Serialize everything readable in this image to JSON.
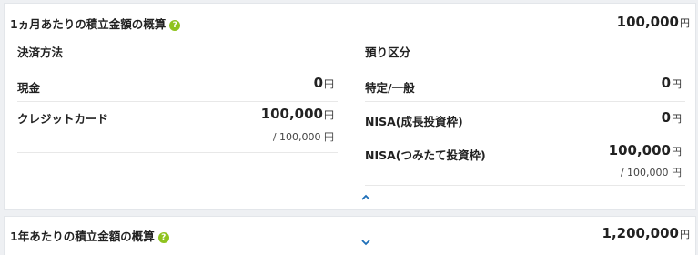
{
  "monthly": {
    "title": "1ヵ月あたりの積立金額の概算",
    "help_icon": "question-mark-icon",
    "total_value": "100,000",
    "unit": "円",
    "payment": {
      "heading": "決済方法",
      "rows": [
        {
          "label": "現金",
          "amount": "0",
          "unit": "円",
          "sub": ""
        },
        {
          "label": "クレジットカード",
          "amount": "100,000",
          "unit": "円",
          "sub": "/ 100,000 円"
        }
      ]
    },
    "deposit": {
      "heading": "預り区分",
      "rows": [
        {
          "label": "特定/一般",
          "amount": "0",
          "unit": "円",
          "sub": ""
        },
        {
          "label": "NISA(成長投資枠)",
          "amount": "0",
          "unit": "円",
          "sub": ""
        },
        {
          "label": "NISA(つみたて投資枠)",
          "amount": "100,000",
          "unit": "円",
          "sub": "/ 100,000 円"
        }
      ]
    },
    "collapse_icon": "chevron-up-icon"
  },
  "yearly": {
    "title": "1年あたりの積立金額の概算",
    "help_icon": "question-mark-icon",
    "total_value": "1,200,000",
    "unit": "円",
    "expand_icon": "chevron-down-icon"
  },
  "colors": {
    "help_icon": "#8fc31f",
    "chevron": "#1e6fb8",
    "background": "#eef0f3"
  }
}
